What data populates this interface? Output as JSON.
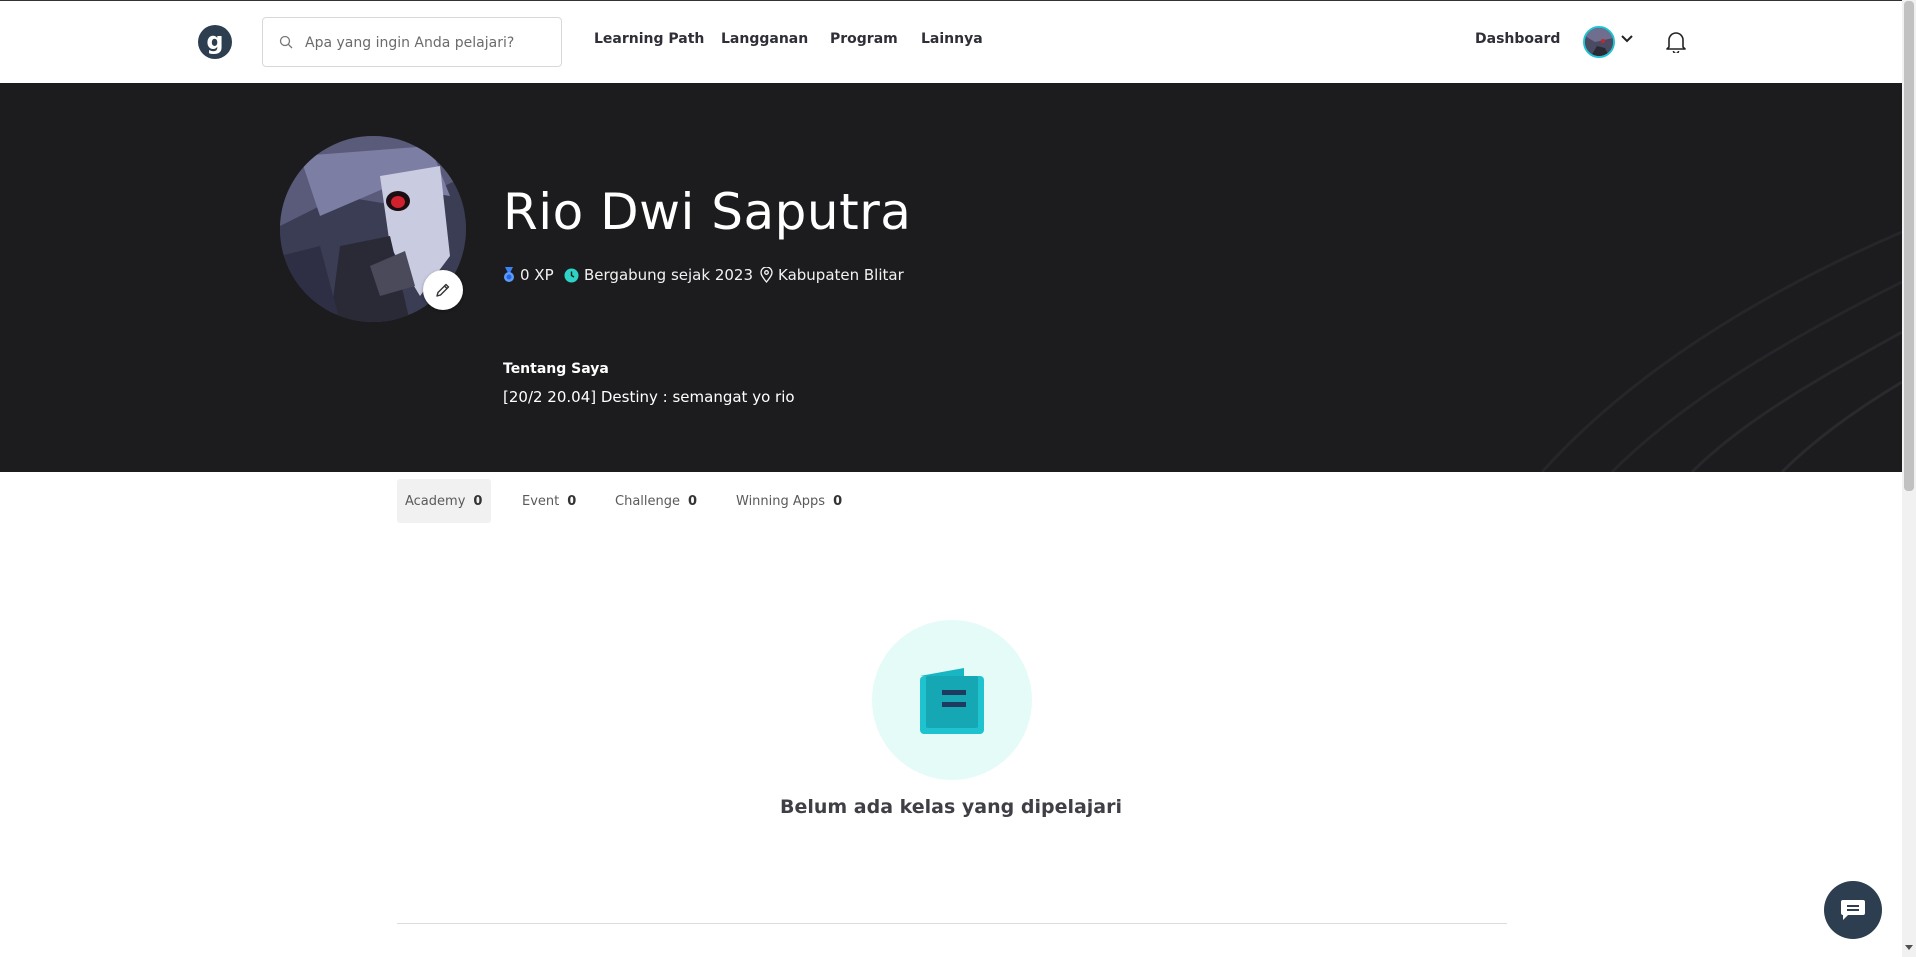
{
  "nav": {
    "logo_text": "g",
    "search_placeholder": "Apa yang ingin Anda pelajari?",
    "links": [
      "Learning Path",
      "Langganan",
      "Program",
      "Lainnya"
    ],
    "dashboard": "Dashboard"
  },
  "profile": {
    "name": "Rio Dwi Saputra",
    "xp": "0 XP",
    "joined": "Bergabung sejak 2023",
    "location": "Kabupaten Blitar",
    "about_title": "Tentang Saya",
    "about_text": "[20/2 20.04] Destiny : semangat yo rio"
  },
  "tabs": [
    {
      "label": "Academy",
      "count": "0"
    },
    {
      "label": "Event",
      "count": "0"
    },
    {
      "label": "Challenge",
      "count": "0"
    },
    {
      "label": "Winning Apps",
      "count": "0"
    }
  ],
  "empty_state": {
    "message": "Belum ada kelas yang dipelajari"
  },
  "colors": {
    "hero_bg": "#1c1c1f",
    "accent": "#20c4d0",
    "brand": "#2d3e50",
    "empty_circle": "#e4fbf8"
  }
}
